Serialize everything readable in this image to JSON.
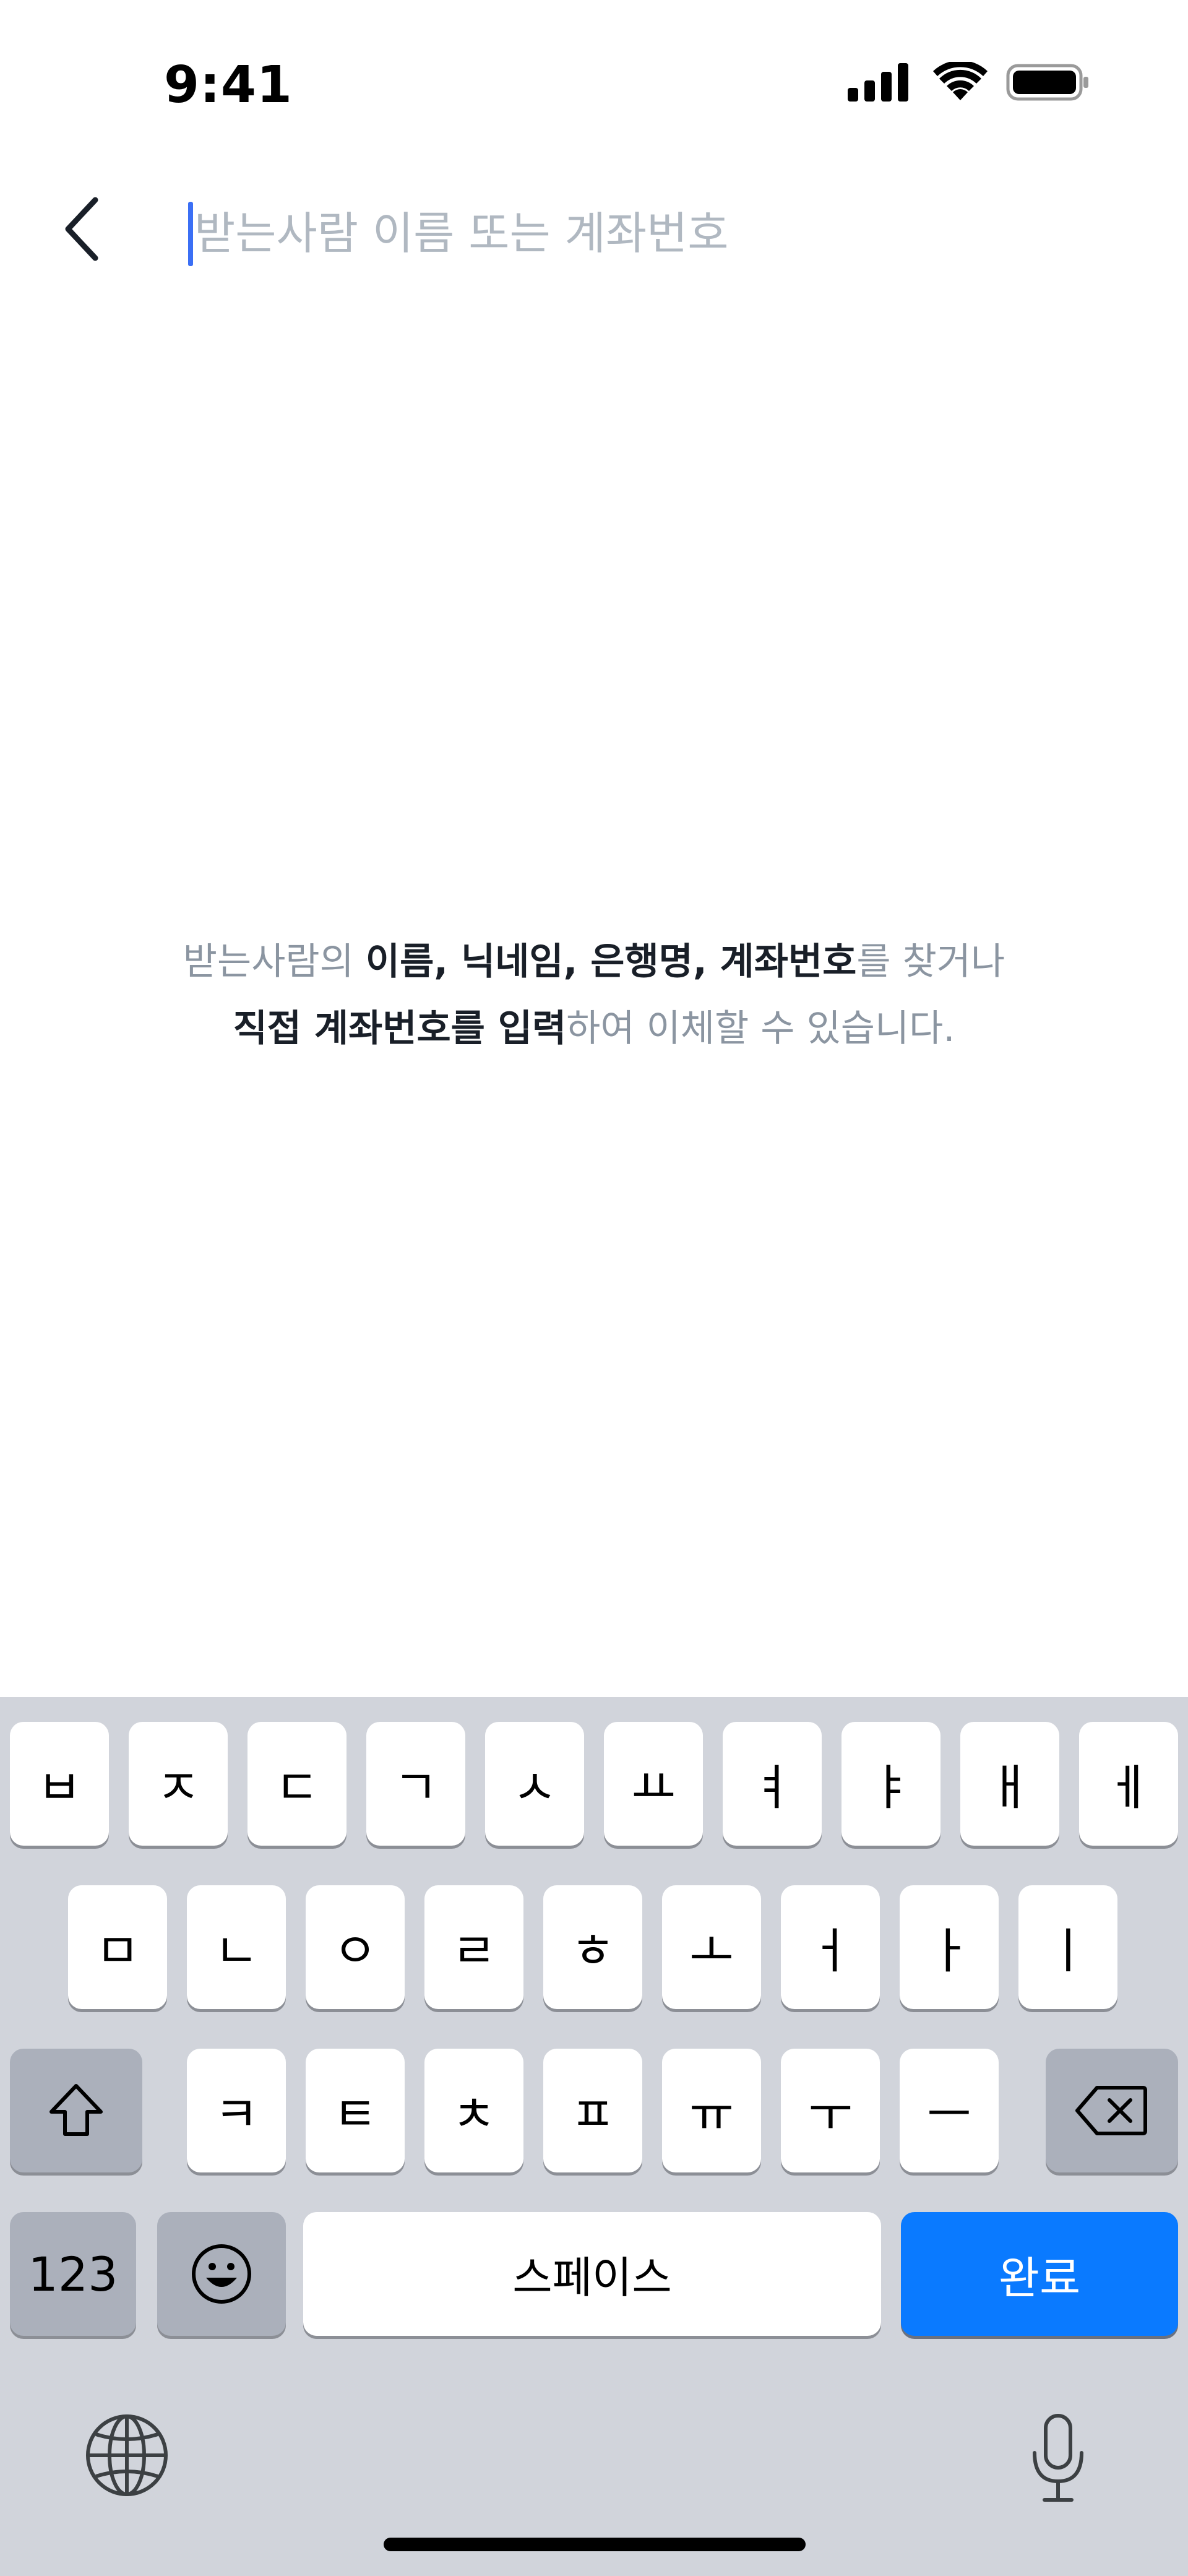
{
  "status_bar": {
    "time": "9:41",
    "icons": [
      "signal-bars-icon",
      "wifi-icon",
      "battery-icon"
    ]
  },
  "search": {
    "back_icon": "chevron-left-icon",
    "placeholder": "받는사람 이름 또는 계좌번호",
    "value": "",
    "caret_color": "#3b6ff5"
  },
  "guide": {
    "line1_a": "받는사람의 ",
    "line1_b": "이름, 닉네임, 은행명, 계좌번호",
    "line1_c": "를 찾거나",
    "line2_a": "직접 계좌번호를 입력",
    "line2_b": "하여 이체할 수 있습니다."
  },
  "keyboard": {
    "row1": [
      "ㅂ",
      "ㅈ",
      "ㄷ",
      "ㄱ",
      "ㅅ",
      "ㅛ",
      "ㅕ",
      "ㅑ",
      "ㅐ",
      "ㅔ"
    ],
    "row2": [
      "ㅁ",
      "ㄴ",
      "ㅇ",
      "ㄹ",
      "ㅎ",
      "ㅗ",
      "ㅓ",
      "ㅏ",
      "ㅣ"
    ],
    "row3": [
      "ㅋ",
      "ㅌ",
      "ㅊ",
      "ㅍ",
      "ㅠ",
      "ㅜ",
      "ㅡ"
    ],
    "numbers_label": "123",
    "space_label": "스페이스",
    "done_label": "완료",
    "done_color": "#0a7aff",
    "icons": [
      "shift-icon",
      "delete-icon",
      "emoji-icon",
      "globe-icon",
      "microphone-icon"
    ]
  }
}
